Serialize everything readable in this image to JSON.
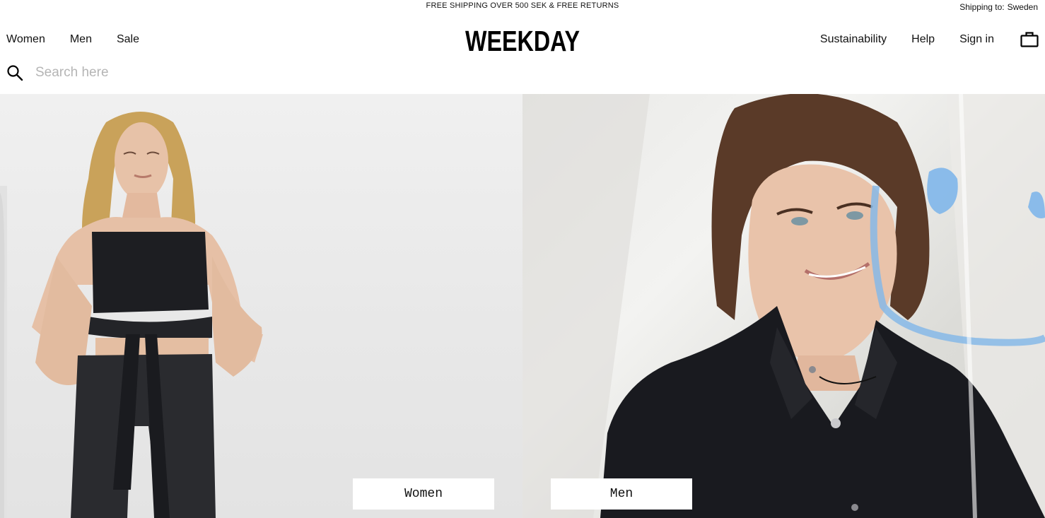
{
  "topbar": {
    "promo": "FREE SHIPPING OVER 500 SEK & FREE RETURNS",
    "shipping_label": "Shipping to:",
    "shipping_country": "Sweden"
  },
  "header": {
    "logo_text": "WEEKDAY",
    "nav_left": [
      {
        "label": "Women"
      },
      {
        "label": "Men"
      },
      {
        "label": "Sale"
      }
    ],
    "nav_right": [
      {
        "label": "Sustainability"
      },
      {
        "label": "Help"
      },
      {
        "label": "Sign in"
      }
    ],
    "bag_icon": "shopping-bag-icon"
  },
  "search": {
    "icon": "search-icon",
    "placeholder": "Search here",
    "value": ""
  },
  "hero": {
    "women_cta": "Women",
    "men_cta": "Men"
  }
}
